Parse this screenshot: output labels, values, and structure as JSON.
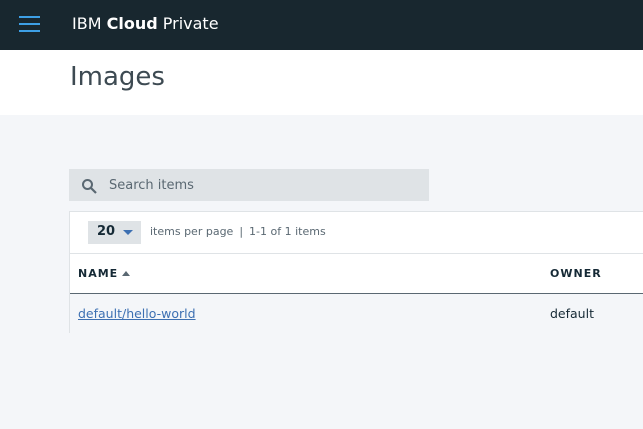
{
  "header": {
    "brand_prefix": "IBM",
    "brand_bold": "Cloud",
    "brand_suffix": "Private",
    "menu_icon": "hamburger-menu-icon"
  },
  "page": {
    "title": "Images"
  },
  "search": {
    "placeholder": "Search items",
    "value": "",
    "icon": "search-icon"
  },
  "pagination": {
    "per_page_value": "20",
    "per_page_label": "items per page",
    "separator": "|",
    "range_text": "1-1 of 1 items"
  },
  "table": {
    "columns": [
      {
        "label": "NAME",
        "sorted": "ascending"
      },
      {
        "label": "OWNER"
      }
    ],
    "rows": [
      {
        "name": "default/hello-world",
        "owner": "default"
      }
    ]
  },
  "colors": {
    "topbar": "#18272f",
    "accent": "#3d9fe5",
    "link": "#3d70b2",
    "page_bg": "#f4f6f9"
  }
}
